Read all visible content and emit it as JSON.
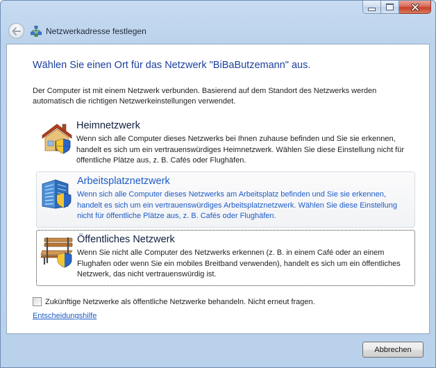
{
  "window": {
    "title": "Netzwerkadresse festlegen",
    "caption_buttons": [
      "minimize-icon",
      "maximize-icon",
      "close-icon"
    ]
  },
  "main": {
    "heading": "Wählen Sie einen Ort für das Netzwerk \"BiBaButzemann\" aus.",
    "intro": "Der Computer ist mit einem Netzwerk verbunden. Basierend auf dem Standort des Netzwerks werden automatisch die richtigen Netzwerkeinstellungen verwendet.",
    "options": [
      {
        "title": "Heimnetzwerk",
        "description": "Wenn sich alle Computer dieses Netzwerks bei Ihnen zuhause befinden und Sie sie erkennen, handelt es sich um ein vertrauenswürdiges Heimnetzwerk. Wählen Sie diese Einstellung nicht für öffentliche Plätze aus, z. B. Cafés oder Flughäfen.",
        "icon": "home-icon"
      },
      {
        "title": "Arbeitsplatznetzwerk",
        "description": "Wenn sich alle Computer dieses Netzwerks am Arbeitsplatz befinden und Sie sie erkennen, handelt es sich um ein vertrauenswürdiges Arbeitsplatznetzwerk. Wählen Sie diese Einstellung nicht für öffentliche Plätze aus, z. B. Cafés oder Flughäfen.",
        "icon": "office-building-icon"
      },
      {
        "title": "Öffentliches Netzwerk",
        "description": "Wenn Sie nicht alle Computer des Netzwerks erkennen (z. B. in einem Café oder an einem Flughafen oder wenn Sie ein mobiles Breitband verwenden), handelt es sich um ein öffentliches Netzwerk, das nicht vertrauenswürdig ist.",
        "icon": "park-bench-icon"
      }
    ],
    "checkbox_label": "Zukünftige Netzwerke als öffentliche Netzwerke behandeln. Nicht erneut fragen.",
    "help_link": "Entscheidungshilfe"
  },
  "footer": {
    "cancel_label": "Abbrechen"
  },
  "colors": {
    "heading": "#1a3f9c",
    "link": "#1c5bc7",
    "frame": "#b9d1ea"
  }
}
